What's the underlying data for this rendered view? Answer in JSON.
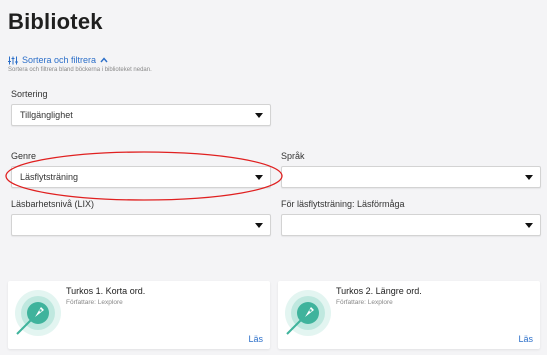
{
  "page": {
    "title": "Bibliotek"
  },
  "filter": {
    "toggle_label": "Sortera och filtrera",
    "hint": "Sortera och filtrera bland böckerna i biblioteket nedan."
  },
  "sorting": {
    "label": "Sortering",
    "value": "Tillgänglighet"
  },
  "genre": {
    "label": "Genre",
    "value": "Läsflytsträning"
  },
  "language": {
    "label": "Språk",
    "value": ""
  },
  "readability": {
    "label": "Läsbarhetsnivå (LIX)",
    "value": ""
  },
  "fluency": {
    "label": "För läsflytsträning: Läsförmåga",
    "value": ""
  },
  "books": [
    {
      "title": "Turkos 1. Korta ord.",
      "author": "Författare: Lexplore",
      "action": "Läs"
    },
    {
      "title": "Turkos 2. Längre ord.",
      "author": "Författare: Lexplore",
      "action": "Läs"
    }
  ],
  "colors": {
    "accent": "#2c6fc9",
    "highlight_ellipse": "#e02020",
    "book_icon": "#3fb39c"
  }
}
